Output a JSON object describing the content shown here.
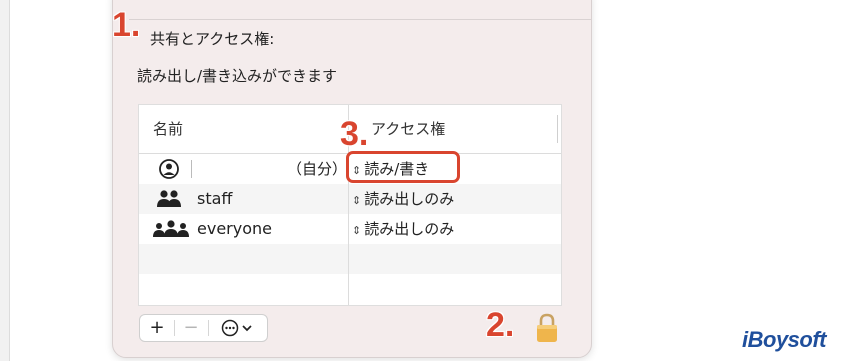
{
  "sharing": {
    "section_title": "共有とアクセス権:",
    "permission_status": "読み出し/書き込みができます",
    "columns": {
      "name": "名前",
      "access": "アクセス権"
    },
    "rows": [
      {
        "icon": "user-circle-icon",
        "name": "",
        "suffix": "（自分）",
        "access": "読み/書き"
      },
      {
        "icon": "group-icon",
        "name": "staff",
        "access": "読み出しのみ"
      },
      {
        "icon": "everyone-icon",
        "name": "everyone",
        "access": "読み出しのみ"
      }
    ],
    "access_chevron": "up-down-chevron-icon",
    "toolbar": {
      "add": "+",
      "remove": "−",
      "more": "ellipsis-circle-icon"
    },
    "lock": "lock-icon"
  },
  "annotations": {
    "step1": "1.",
    "step2": "2.",
    "step3": "3."
  },
  "accent_color": "#d9452f",
  "watermark": "iBoysoft"
}
